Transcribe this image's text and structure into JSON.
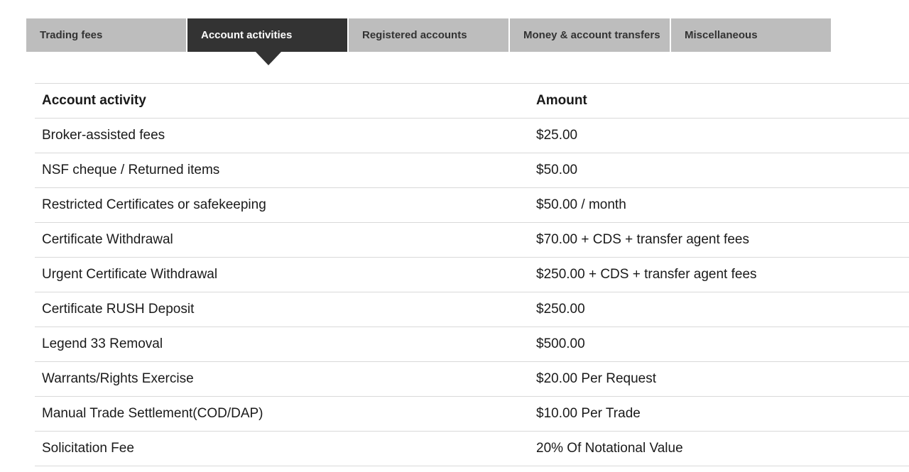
{
  "tabs": [
    {
      "label": "Trading fees",
      "active": false
    },
    {
      "label": "Account activities",
      "active": true
    },
    {
      "label": "Registered accounts",
      "active": false
    },
    {
      "label": "Money & account transfers",
      "active": false
    },
    {
      "label": "Miscellaneous",
      "active": false
    }
  ],
  "table": {
    "headers": {
      "activity": "Account activity",
      "amount": "Amount"
    },
    "rows": [
      {
        "activity": "Broker-assisted fees",
        "amount": "$25.00"
      },
      {
        "activity": "NSF cheque / Returned items",
        "amount": "$50.00"
      },
      {
        "activity": "Restricted Certificates or safekeeping",
        "amount": "$50.00 / month"
      },
      {
        "activity": "Certificate Withdrawal",
        "amount": "$70.00 + CDS + transfer agent fees"
      },
      {
        "activity": "Urgent Certificate Withdrawal",
        "amount": "$250.00 + CDS + transfer agent fees"
      },
      {
        "activity": "Certificate RUSH Deposit",
        "amount": "$250.00"
      },
      {
        "activity": "Legend 33 Removal",
        "amount": "$500.00"
      },
      {
        "activity": "Warrants/Rights Exercise",
        "amount": "$20.00 Per Request"
      },
      {
        "activity": "Manual Trade Settlement(COD/DAP)",
        "amount": "$10.00 Per Trade"
      },
      {
        "activity": "Solicitation Fee",
        "amount": "20% Of Notational Value"
      }
    ]
  },
  "colors": {
    "tab_inactive": "#bdbdbd",
    "tab_active": "#333333",
    "divider": "#d9d9d9"
  }
}
